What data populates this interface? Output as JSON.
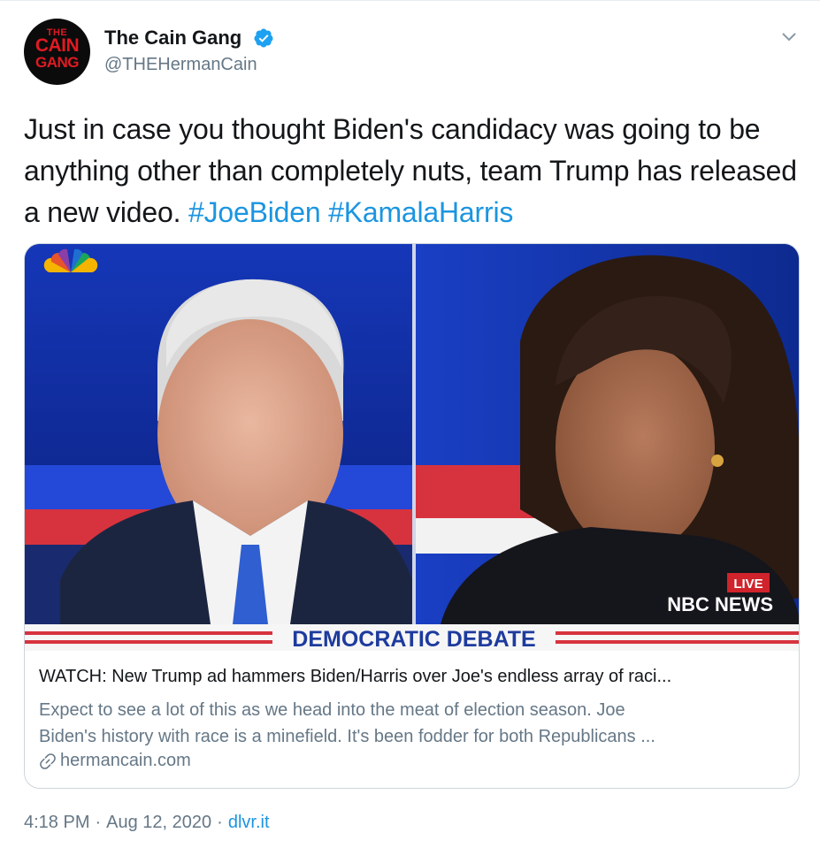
{
  "author": {
    "name": "The Cain Gang",
    "handle": "@THEHermanCain",
    "avatar_text": {
      "line1": "THE",
      "line2": "CAIN",
      "line3": "GANG"
    },
    "verified": true
  },
  "menu_icon": "chevron-down-icon",
  "tweet": {
    "text": "Just in case you thought Biden's candidacy was going to be anything other than completely nuts, team Trump has released a new video.",
    "hashtags": [
      "#JoeBiden",
      "#KamalaHarris"
    ]
  },
  "card": {
    "media_text": {
      "banner": "DEMOCRATIC DEBATE",
      "live": "LIVE",
      "network": "NBC NEWS"
    },
    "title": "WATCH: New Trump ad hammers Biden/Harris over Joe's endless array of raci...",
    "description_lines": [
      "Expect to see a lot of this as we head into the meat of election season. Joe",
      "Biden's history with race is a minefield.  It's been fodder for both Republicans ..."
    ],
    "domain": "hermancain.com"
  },
  "footer": {
    "time": "4:18 PM",
    "date": "Aug 12, 2020",
    "source": "dlvr.it",
    "separator": "·"
  },
  "colors": {
    "link": "#1b95e0",
    "secondary_text": "#657786",
    "verified": "#1da1f2",
    "border": "#ccd6dd"
  }
}
